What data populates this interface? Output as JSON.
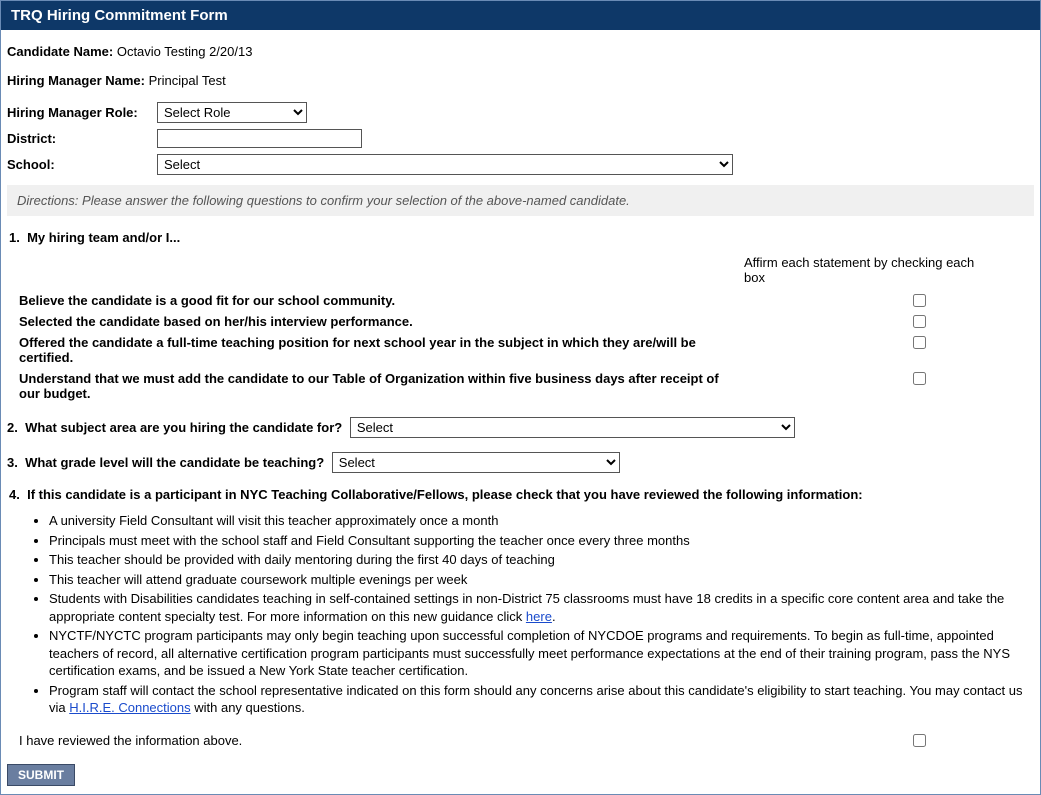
{
  "header": {
    "title": "TRQ Hiring Commitment Form"
  },
  "candidate": {
    "label": "Candidate Name:",
    "value": "Octavio Testing 2/20/13"
  },
  "hiring_manager": {
    "label": "Hiring Manager Name:",
    "value": "Principal Test"
  },
  "role": {
    "label": "Hiring Manager Role:",
    "selected": "Select Role"
  },
  "district": {
    "label": "District:",
    "value": ""
  },
  "school": {
    "label": "School:",
    "selected": "Select"
  },
  "directions": "Directions: Please answer the following questions to confirm your selection of the above-named candidate.",
  "q1": {
    "num": "1.",
    "title": "My hiring team and/or I...",
    "affirm_header": "Affirm each statement by checking each box",
    "statements": [
      "Believe the candidate is a good fit for our school community.",
      "Selected the candidate based on her/his interview performance.",
      "Offered the candidate a full-time teaching position for next school year in the subject in which they are/will be certified.",
      "Understand that we must add the candidate to our Table of Organization within five business days after receipt of our budget."
    ]
  },
  "q2": {
    "num": "2.",
    "title": "What subject area are you hiring the candidate for?",
    "selected": "Select"
  },
  "q3": {
    "num": "3.",
    "title": "What grade level will the candidate be teaching?",
    "selected": "Select"
  },
  "q4": {
    "num": "4.",
    "title": "If this candidate is a participant in NYC Teaching Collaborative/Fellows, please check that you have reviewed the following information:",
    "bullets": [
      {
        "text": "A university Field Consultant will visit this teacher approximately once a month"
      },
      {
        "text": "Principals must meet with the school staff and Field Consultant supporting the teacher once every three months"
      },
      {
        "text": "This teacher should be provided with daily mentoring during the first 40 days of teaching"
      },
      {
        "text": "This teacher will attend graduate coursework multiple evenings per week"
      },
      {
        "text_before": "Students with Disabilities candidates teaching in self-contained settings in non-District 75 classrooms must have 18 credits in a specific core content area and take the appropriate content specialty test. For more information on this new guidance click ",
        "link": "here",
        "text_after": "."
      },
      {
        "text": "NYCTF/NYCTC program participants may only begin teaching upon successful completion of NYCDOE programs and requirements. To begin as full-time, appointed teachers of record, all alternative certification program participants must successfully meet performance expectations at the end of their training program, pass the NYS certification exams, and be issued a New York State teacher certification."
      },
      {
        "text_before": "Program staff will contact the school representative indicated on this form should any concerns arise about this candidate's eligibility to start teaching. You may contact us via ",
        "link": "H.I.R.E. Connections",
        "text_after": " with any questions."
      }
    ],
    "review_label": "I have reviewed the information above."
  },
  "submit": {
    "label": "SUBMIT"
  }
}
